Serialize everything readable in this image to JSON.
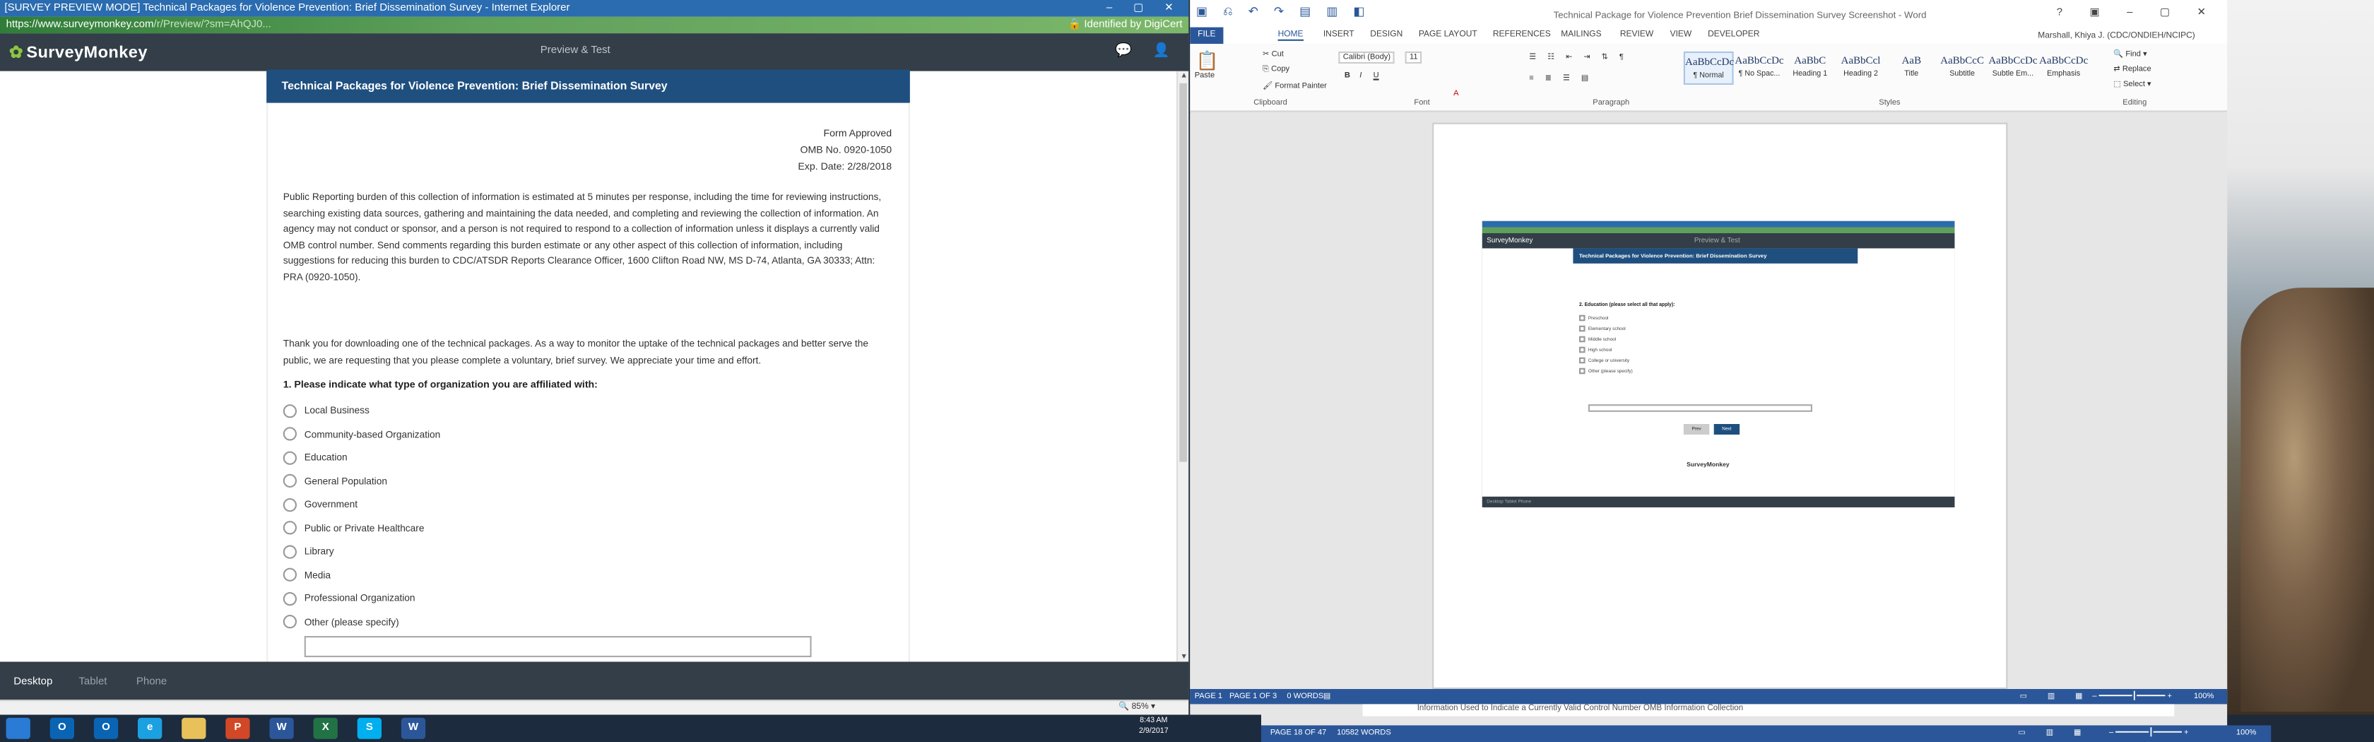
{
  "ie": {
    "title": "[SURVEY PREVIEW MODE] Technical Packages for Violence Prevention: Brief Dissemination Survey - Internet Explorer",
    "url_host": "https://www.surveymonkey.com",
    "url_rest": "/r/Preview/?sm=AhQJ0...",
    "cert": "Identified by DigiCert",
    "zoom": "85%"
  },
  "surveymonkey": {
    "logo": "SurveyMonkey",
    "preview_label": "Preview & Test",
    "device_tabs": [
      "Desktop",
      "Tablet",
      "Phone"
    ]
  },
  "survey": {
    "title": "Technical Packages for Violence Prevention: Brief Dissemination Survey",
    "form_approved": "Form Approved",
    "omb": "OMB No. 0920-1050",
    "exp": "Exp. Date: 2/28/2018",
    "burden": "Public Reporting burden of this collection of information is estimated at 5 minutes per response, including the time for reviewing instructions, searching existing data sources, gathering and maintaining the data needed, and completing and reviewing the collection of information.  An agency may not conduct or sponsor, and a person is not required to respond to a collection of information unless it displays a currently valid OMB control number.  Send comments regarding this burden estimate or any other aspect of this collection of information, including suggestions for reducing this burden to CDC/ATSDR Reports Clearance Officer, 1600 Clifton Road NW, MS D-74, Atlanta, GA  30333; Attn:  PRA (0920-1050).",
    "thanks": "Thank you for downloading one of the technical packages. As a way to monitor the uptake of the technical packages and better serve the public, we are requesting that you please complete a voluntary, brief survey. We appreciate your time and effort.",
    "question": "1. Please indicate what type of organization you are affiliated with:",
    "options": [
      "Local Business",
      "Community-based Organization",
      "Education",
      "General Population",
      "Government",
      "Public or Private Healthcare",
      "Library",
      "Media",
      "Professional Organization",
      "Other (please specify)"
    ]
  },
  "word": {
    "doc_title": "Technical Package for Violence Prevention Brief Dissemination Survey Screenshot - Word",
    "user": "Marshall, Khiya J. (CDC/ONDIEH/NCIPC)",
    "menu": [
      "FILE",
      "HOME",
      "INSERT",
      "DESIGN",
      "PAGE LAYOUT",
      "REFERENCES",
      "MAILINGS",
      "REVIEW",
      "VIEW",
      "DEVELOPER"
    ],
    "clipboard": {
      "paste": "Paste",
      "cut": "Cut",
      "copy": "Copy",
      "format_painter": "Format Painter",
      "label": "Clipboard"
    },
    "font": {
      "name": "Calibri (Body)",
      "size": "11",
      "label": "Font"
    },
    "paragraph_label": "Paragraph",
    "styles": [
      {
        "preview": "AaBbCcDc",
        "name": "¶ Normal"
      },
      {
        "preview": "AaBbCcDc",
        "name": "¶ No Spac..."
      },
      {
        "preview": "AaBbC",
        "name": "Heading 1"
      },
      {
        "preview": "AaBbCcl",
        "name": "Heading 2"
      },
      {
        "preview": "AaB",
        "name": "Title"
      },
      {
        "preview": "AaBbCcC",
        "name": "Subtitle"
      },
      {
        "preview": "AaBbCcDc",
        "name": "Subtle Em..."
      },
      {
        "preview": "AaBbCcDc",
        "name": "Emphasis"
      }
    ],
    "styles_label": "Styles",
    "editing": {
      "find": "Find",
      "replace": "Replace",
      "select": "Select",
      "label": "Editing"
    },
    "status": {
      "page": "PAGE 1 OF 3",
      "words": "0 WORDS",
      "zoom": "100%",
      "page_short": "PAGE 1"
    },
    "embedded": {
      "logo": "SurveyMonkey",
      "preview": "Preview & Test",
      "title": "Technical Packages for Violence Prevention: Brief Dissemination Survey",
      "question": "2. Education (please select all that apply):",
      "options": [
        "Preschool",
        "Elementary school",
        "Middle school",
        "High school",
        "College or university",
        "Other (please specify)"
      ],
      "prev": "Prev",
      "next": "Next",
      "powered": "SurveyMonkey",
      "foot": "Desktop   Tablet   Phone"
    }
  },
  "word2": {
    "strip_text": "Information Used to Indicate a Currently Valid Control Number    OMB Information Collection",
    "page": "PAGE 18 OF 47",
    "words": "10582 WORDS",
    "zoom": "100%"
  },
  "taskbar": {
    "apps": [
      {
        "icon": "windows-start-icon",
        "label": "",
        "color": "#2a7bd5"
      },
      {
        "icon": "outlook-icon",
        "label": "O",
        "color": "#0a64b4"
      },
      {
        "icon": "outlook-icon",
        "label": "O",
        "color": "#0a64b4"
      },
      {
        "icon": "internet-explorer-icon",
        "label": "e",
        "color": "#1ba1e2"
      },
      {
        "icon": "file-explorer-icon",
        "label": "",
        "color": "#e8c15a"
      },
      {
        "icon": "powerpoint-icon",
        "label": "P",
        "color": "#d24726"
      },
      {
        "icon": "word-icon",
        "label": "W",
        "color": "#2b579a"
      },
      {
        "icon": "excel-icon",
        "label": "X",
        "color": "#217346"
      },
      {
        "icon": "skype-icon",
        "label": "S",
        "color": "#00aff0"
      },
      {
        "icon": "word-icon",
        "label": "W",
        "color": "#2b579a"
      }
    ],
    "time": "8:43 AM",
    "date": "2/9/2017"
  }
}
